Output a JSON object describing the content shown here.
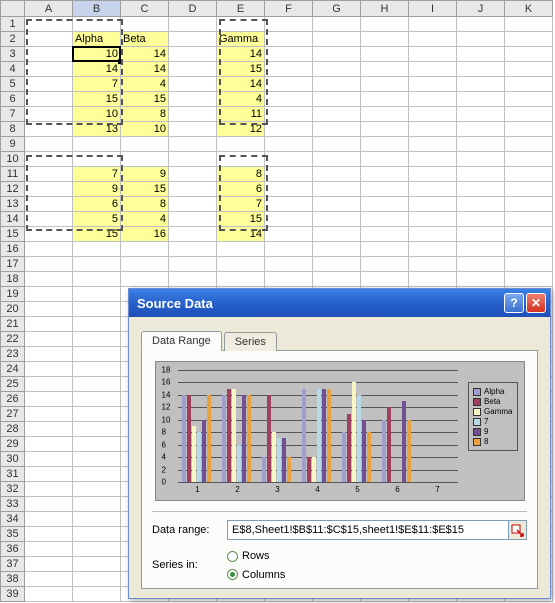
{
  "columns": [
    "A",
    "B",
    "C",
    "D",
    "E",
    "F",
    "G",
    "H",
    "I",
    "J",
    "K"
  ],
  "row_count": 39,
  "headers": {
    "B2": "Alpha",
    "C2": "Beta",
    "E2": "Gamma"
  },
  "cells_block1": {
    "rows": [
      3,
      4,
      5,
      6,
      7,
      8
    ],
    "B": [
      10,
      14,
      7,
      15,
      10,
      13
    ],
    "C": [
      14,
      14,
      4,
      15,
      8,
      10
    ],
    "E": [
      14,
      15,
      14,
      4,
      11,
      12
    ]
  },
  "cells_block2": {
    "rows": [
      11,
      12,
      13,
      14,
      15
    ],
    "B": [
      7,
      9,
      6,
      5,
      15
    ],
    "C": [
      9,
      15,
      8,
      4,
      16
    ],
    "E": [
      8,
      6,
      7,
      15,
      14
    ]
  },
  "active_cell": "B3",
  "dialog": {
    "title": "Source Data",
    "tabs": [
      "Data Range",
      "Series"
    ],
    "active_tab": 0,
    "data_range_label": "Data range:",
    "data_range_value": "E$8,Sheet1!$B$11:$C$15,sheet1!$E$11:$E$15",
    "series_in_label": "Series in:",
    "series_in_options": [
      "Rows",
      "Columns"
    ],
    "series_in_selected": "Columns",
    "help_symbol": "?",
    "close_symbol": "✕"
  },
  "chart_data": {
    "type": "bar",
    "ylim": [
      0,
      18
    ],
    "yticks": [
      0,
      2,
      4,
      6,
      8,
      10,
      12,
      14,
      16,
      18
    ],
    "categories": [
      "1",
      "2",
      "3",
      "4",
      "5",
      "6",
      "7"
    ],
    "series": [
      {
        "name": "Alpha",
        "values": [
          14,
          14,
          4,
          15,
          8,
          10,
          null
        ]
      },
      {
        "name": "Beta",
        "values": [
          14,
          15,
          14,
          4,
          11,
          12,
          null
        ]
      },
      {
        "name": "Gamma",
        "values": [
          9,
          15,
          8,
          4,
          16,
          null,
          null
        ]
      },
      {
        "name": "7",
        "values": [
          8,
          6,
          7,
          15,
          14,
          null,
          null
        ]
      },
      {
        "name": "9",
        "values": [
          10,
          14,
          7,
          15,
          10,
          13,
          null
        ]
      },
      {
        "name": "8",
        "values": [
          14,
          14,
          4,
          15,
          8,
          10,
          null
        ]
      }
    ],
    "legend_position": "right",
    "grid": true
  }
}
